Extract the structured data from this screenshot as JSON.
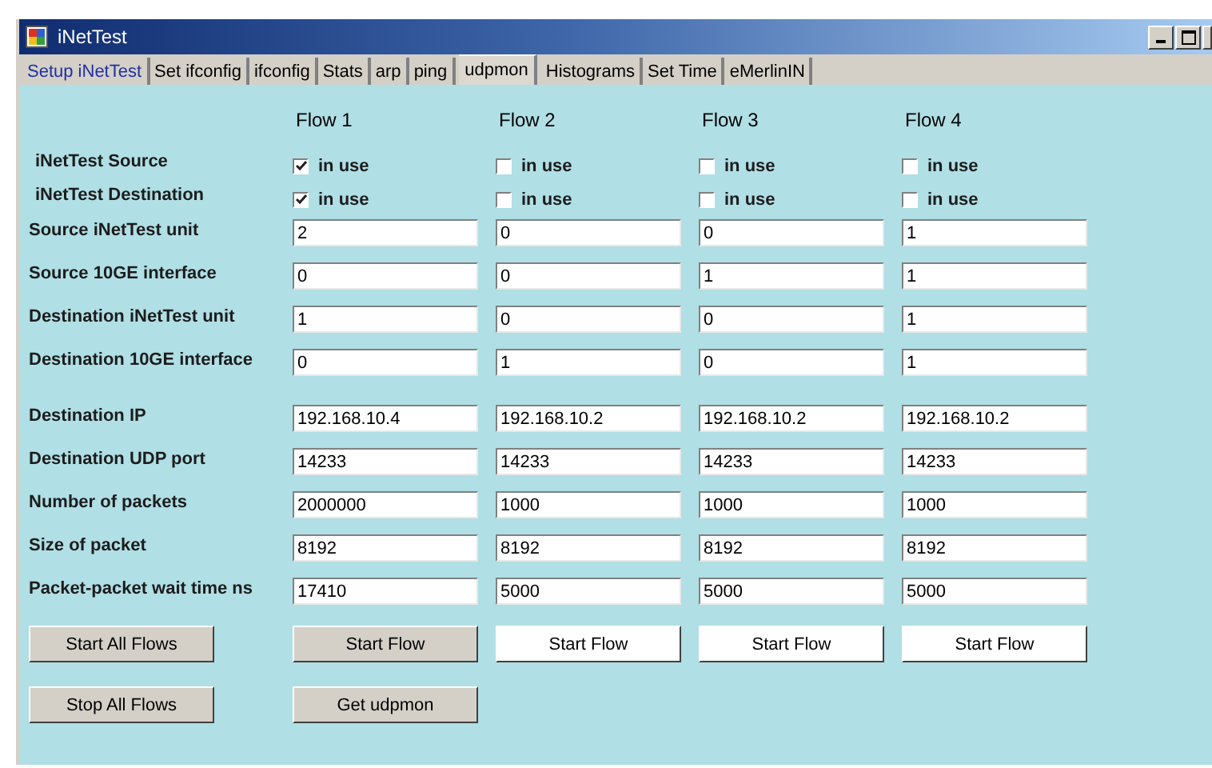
{
  "window": {
    "title": "iNetTest"
  },
  "tabs": [
    {
      "label": "Setup iNetTest",
      "selected": false,
      "hover": true
    },
    {
      "label": "Set ifconfig",
      "selected": false,
      "hover": false
    },
    {
      "label": "ifconfig",
      "selected": false,
      "hover": false
    },
    {
      "label": "Stats",
      "selected": false,
      "hover": false
    },
    {
      "label": "arp",
      "selected": false,
      "hover": false
    },
    {
      "label": "ping",
      "selected": false,
      "hover": false
    },
    {
      "label": "udpmon",
      "selected": true,
      "hover": false
    },
    {
      "label": "Histograms",
      "selected": false,
      "hover": false
    },
    {
      "label": "Set Time",
      "selected": false,
      "hover": false
    },
    {
      "label": "eMerlinIN",
      "selected": false,
      "hover": false
    }
  ],
  "flows": [
    "Flow 1",
    "Flow 2",
    "Flow 3",
    "Flow 4"
  ],
  "checkbox_rows": [
    {
      "label": "iNetTest Source",
      "boxes": [
        {
          "label": "in use",
          "checked": true
        },
        {
          "label": "in use",
          "checked": false
        },
        {
          "label": "in use",
          "checked": false
        },
        {
          "label": "in use",
          "checked": false
        }
      ]
    },
    {
      "label": "iNetTest Destination",
      "boxes": [
        {
          "label": "in use",
          "checked": true
        },
        {
          "label": "in use",
          "checked": false
        },
        {
          "label": "in use",
          "checked": false
        },
        {
          "label": "in use",
          "checked": false
        }
      ]
    }
  ],
  "field_groups": [
    [
      {
        "label": "Source iNetTest unit",
        "values": [
          "2",
          "0",
          "0",
          "1"
        ]
      },
      {
        "label": "Source 10GE interface",
        "values": [
          "0",
          "0",
          "1",
          "1"
        ]
      },
      {
        "label": "Destination iNetTest unit",
        "values": [
          "1",
          "0",
          "0",
          "1"
        ]
      },
      {
        "label": "Destination 10GE interface",
        "values": [
          "0",
          "1",
          "0",
          "1"
        ]
      }
    ],
    [
      {
        "label": "Destination IP",
        "values": [
          "192.168.10.4",
          "192.168.10.2",
          "192.168.10.2",
          "192.168.10.2"
        ]
      },
      {
        "label": "Destination UDP port",
        "values": [
          "14233",
          "14233",
          "14233",
          "14233"
        ]
      },
      {
        "label": "Number of packets",
        "values": [
          "2000000",
          "1000",
          "1000",
          "1000"
        ]
      },
      {
        "label": "Size of packet",
        "values": [
          "8192",
          "8192",
          "8192",
          "8192"
        ]
      },
      {
        "label": "Packet-packet wait time ns",
        "values": [
          "17410",
          "5000",
          "5000",
          "5000"
        ]
      }
    ]
  ],
  "button_rows": [
    [
      {
        "label": "Start All Flows",
        "kind": "grey"
      },
      {
        "label": "Start Flow",
        "kind": "grey"
      },
      {
        "label": "Start Flow",
        "kind": "white"
      },
      {
        "label": "Start Flow",
        "kind": "white"
      },
      {
        "label": "Start Flow",
        "kind": "white"
      }
    ],
    [
      {
        "label": "Stop All Flows",
        "kind": "grey"
      },
      {
        "label": "Get udpmon",
        "kind": "grey"
      }
    ]
  ]
}
